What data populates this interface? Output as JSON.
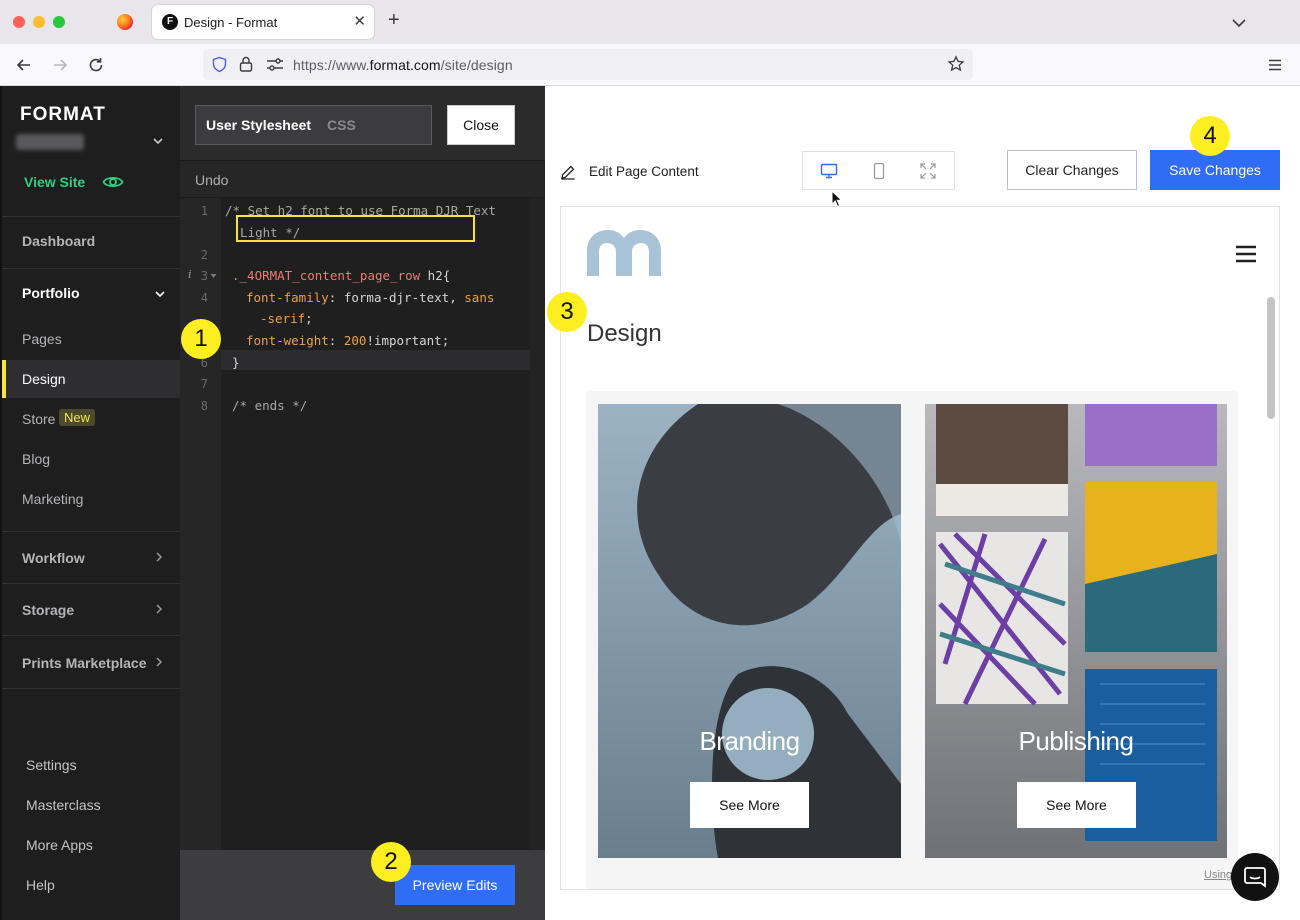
{
  "browser": {
    "tab_title": "Design - Format",
    "tab_favicon": "F",
    "url_prefix": "https://www.",
    "url_domain": "format.com",
    "url_path": "/site/design"
  },
  "sidebar": {
    "brand": "FORMAT",
    "view_site": "View Site",
    "items": {
      "dashboard": "Dashboard",
      "portfolio": "Portfolio",
      "pages": "Pages",
      "design": "Design",
      "store": "Store",
      "store_badge": "New",
      "blog": "Blog",
      "marketing": "Marketing",
      "workflow": "Workflow",
      "storage": "Storage",
      "prints": "Prints Marketplace",
      "settings": "Settings",
      "masterclass": "Masterclass",
      "more_apps": "More Apps",
      "help": "Help"
    }
  },
  "editor": {
    "stylesheet_label": "User Stylesheet",
    "stylesheet_type": "CSS",
    "close_label": "Close",
    "undo_label": "Undo",
    "line_numbers": [
      "1",
      "2",
      "3",
      "4",
      "5",
      "6",
      "7",
      "8"
    ],
    "info_marker": "i",
    "code": {
      "l1a": "/* Set h2 font to use Forma DJR Text",
      "l1b": "  Light */",
      "l3_sel": "._4ORMAT_content_page_row",
      "l3_rest": " h2{",
      "l4_prop": "font-family",
      "l4_val": " forma-djr-text, ",
      "l4_kw": "sans",
      "l4b": "-serif",
      "l5_prop": "font-weight",
      "l5_num": " 200",
      "l5_rest": "!important;",
      "l6": "}",
      "l8": "/* ends */"
    },
    "preview_label": "Preview Edits"
  },
  "preview": {
    "edit_page_label": "Edit Page Content",
    "clear_label": "Clear Changes",
    "save_label": "Save Changes",
    "page_heading": "Design",
    "cards": [
      {
        "title": "Branding",
        "button": "See More"
      },
      {
        "title": "Publishing",
        "button": "See More"
      }
    ],
    "using_label": "Using"
  },
  "callouts": [
    "1",
    "2",
    "3",
    "4"
  ],
  "colors": {
    "accent_blue": "#2f6df5",
    "view_site_green": "#2ed17e",
    "callout_yellow": "#fdee21",
    "active_bar": "#f5e63c"
  }
}
